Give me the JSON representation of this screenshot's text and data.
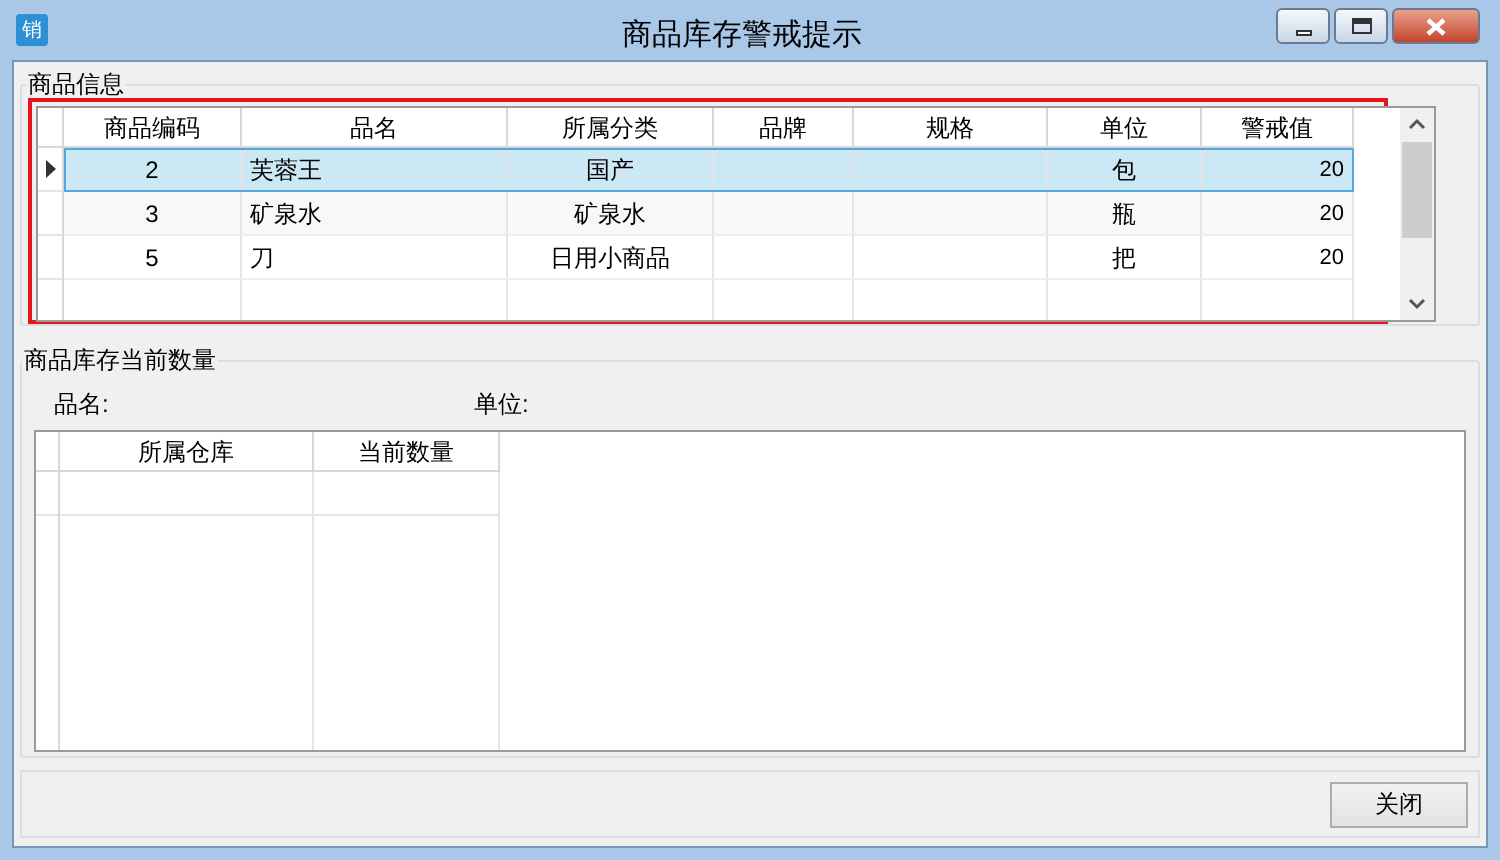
{
  "window": {
    "title": "商品库存警戒提示",
    "icon_text": "销"
  },
  "product_info": {
    "title": "商品信息",
    "columns": [
      "商品编码",
      "品名",
      "所属分类",
      "品牌",
      "规格",
      "单位",
      "警戒值"
    ],
    "rows": [
      {
        "selected": true,
        "cells": [
          "2",
          "芙蓉王",
          "国产",
          "",
          "",
          "包",
          "20"
        ]
      },
      {
        "selected": false,
        "cells": [
          "3",
          "矿泉水",
          "矿泉水",
          "",
          "",
          "瓶",
          "20"
        ]
      },
      {
        "selected": false,
        "cells": [
          "5",
          "刀",
          "日用小商品",
          "",
          "",
          "把",
          "20"
        ]
      }
    ]
  },
  "stock": {
    "title": "商品库存当前数量",
    "name_label": "品名:",
    "unit_label": "单位:",
    "columns": [
      "所属仓库",
      "当前数量"
    ]
  },
  "buttons": [
    {
      "label": "关闭"
    }
  ]
}
